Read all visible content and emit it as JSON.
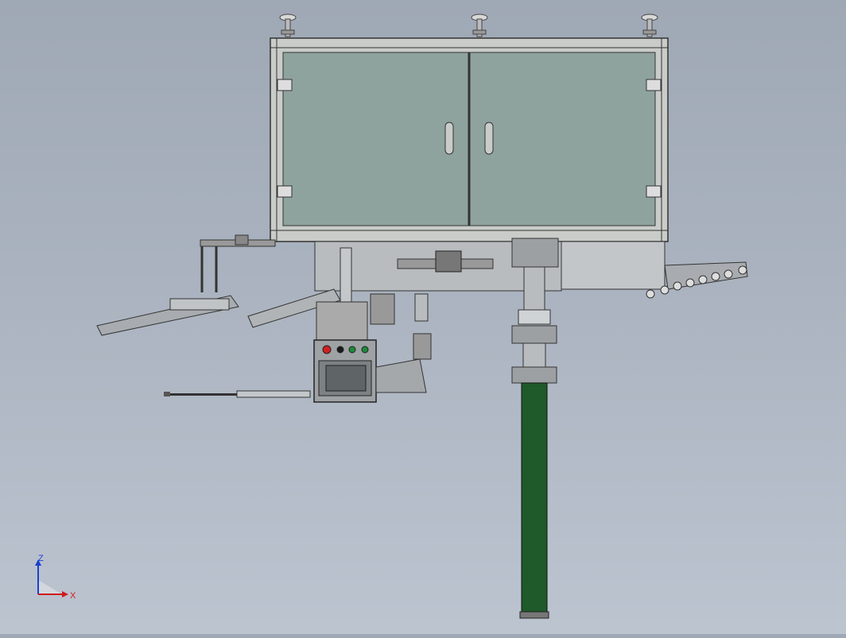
{
  "viewport": {
    "background_top": "#9fa8b5",
    "background_bottom": "#bcc4d0"
  },
  "model": {
    "cabinet_glass_color": "#8fa39e",
    "frame_color": "#c9ccc9",
    "tube_color": "#1f5a2a",
    "panel_button_colors": [
      "#d02020",
      "#1a1a1a",
      "#1e8a3a",
      "#1e8a3a"
    ]
  },
  "triad": {
    "z_label": "Z",
    "x_label": "X",
    "z_color": "#1a3fd0",
    "x_color": "#d01a1a"
  }
}
